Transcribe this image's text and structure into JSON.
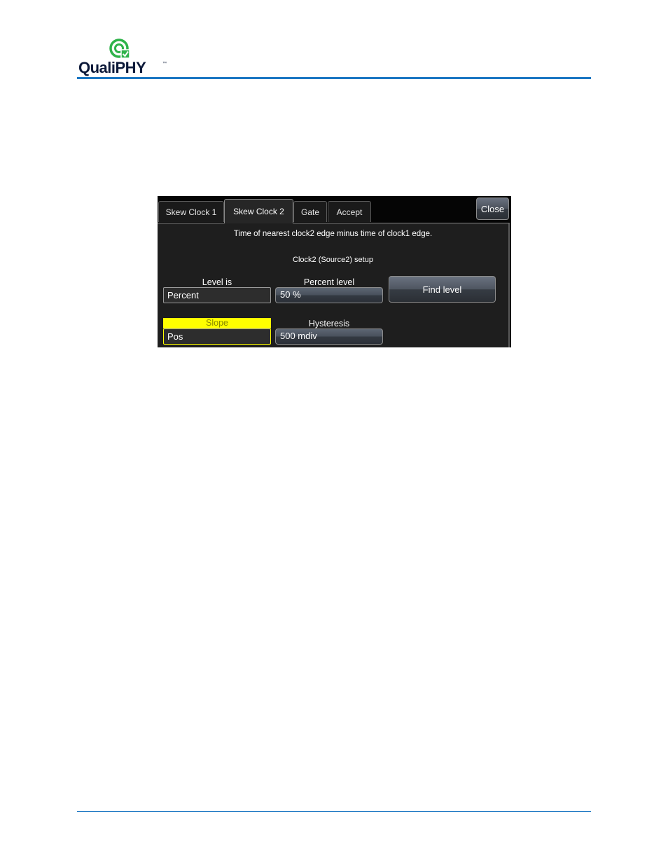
{
  "header": {
    "logo_text": "QualiPHY",
    "logo_tm": "™",
    "brand_color": "#1a76c2",
    "logo_icon": "qualiphy-logo-icon"
  },
  "dialog": {
    "tabs": [
      {
        "label": "Skew Clock 1",
        "active": false
      },
      {
        "label": "Skew Clock 2",
        "active": true
      },
      {
        "label": "Gate",
        "active": false
      },
      {
        "label": "Accept",
        "active": false
      }
    ],
    "close_label": "Close",
    "description": "Time of nearest clock2 edge minus time of clock1 edge.",
    "section_title": "Clock2 (Source2) setup",
    "level_is": {
      "label": "Level is",
      "value": "Percent"
    },
    "percent_level": {
      "label": "Percent level",
      "value": "50 %"
    },
    "find_level_label": "Find level",
    "slope": {
      "label": "Slope",
      "value": "Pos",
      "highlight_color": "#ffff00"
    },
    "hysteresis": {
      "label": "Hysteresis",
      "value": "500 mdiv"
    }
  }
}
